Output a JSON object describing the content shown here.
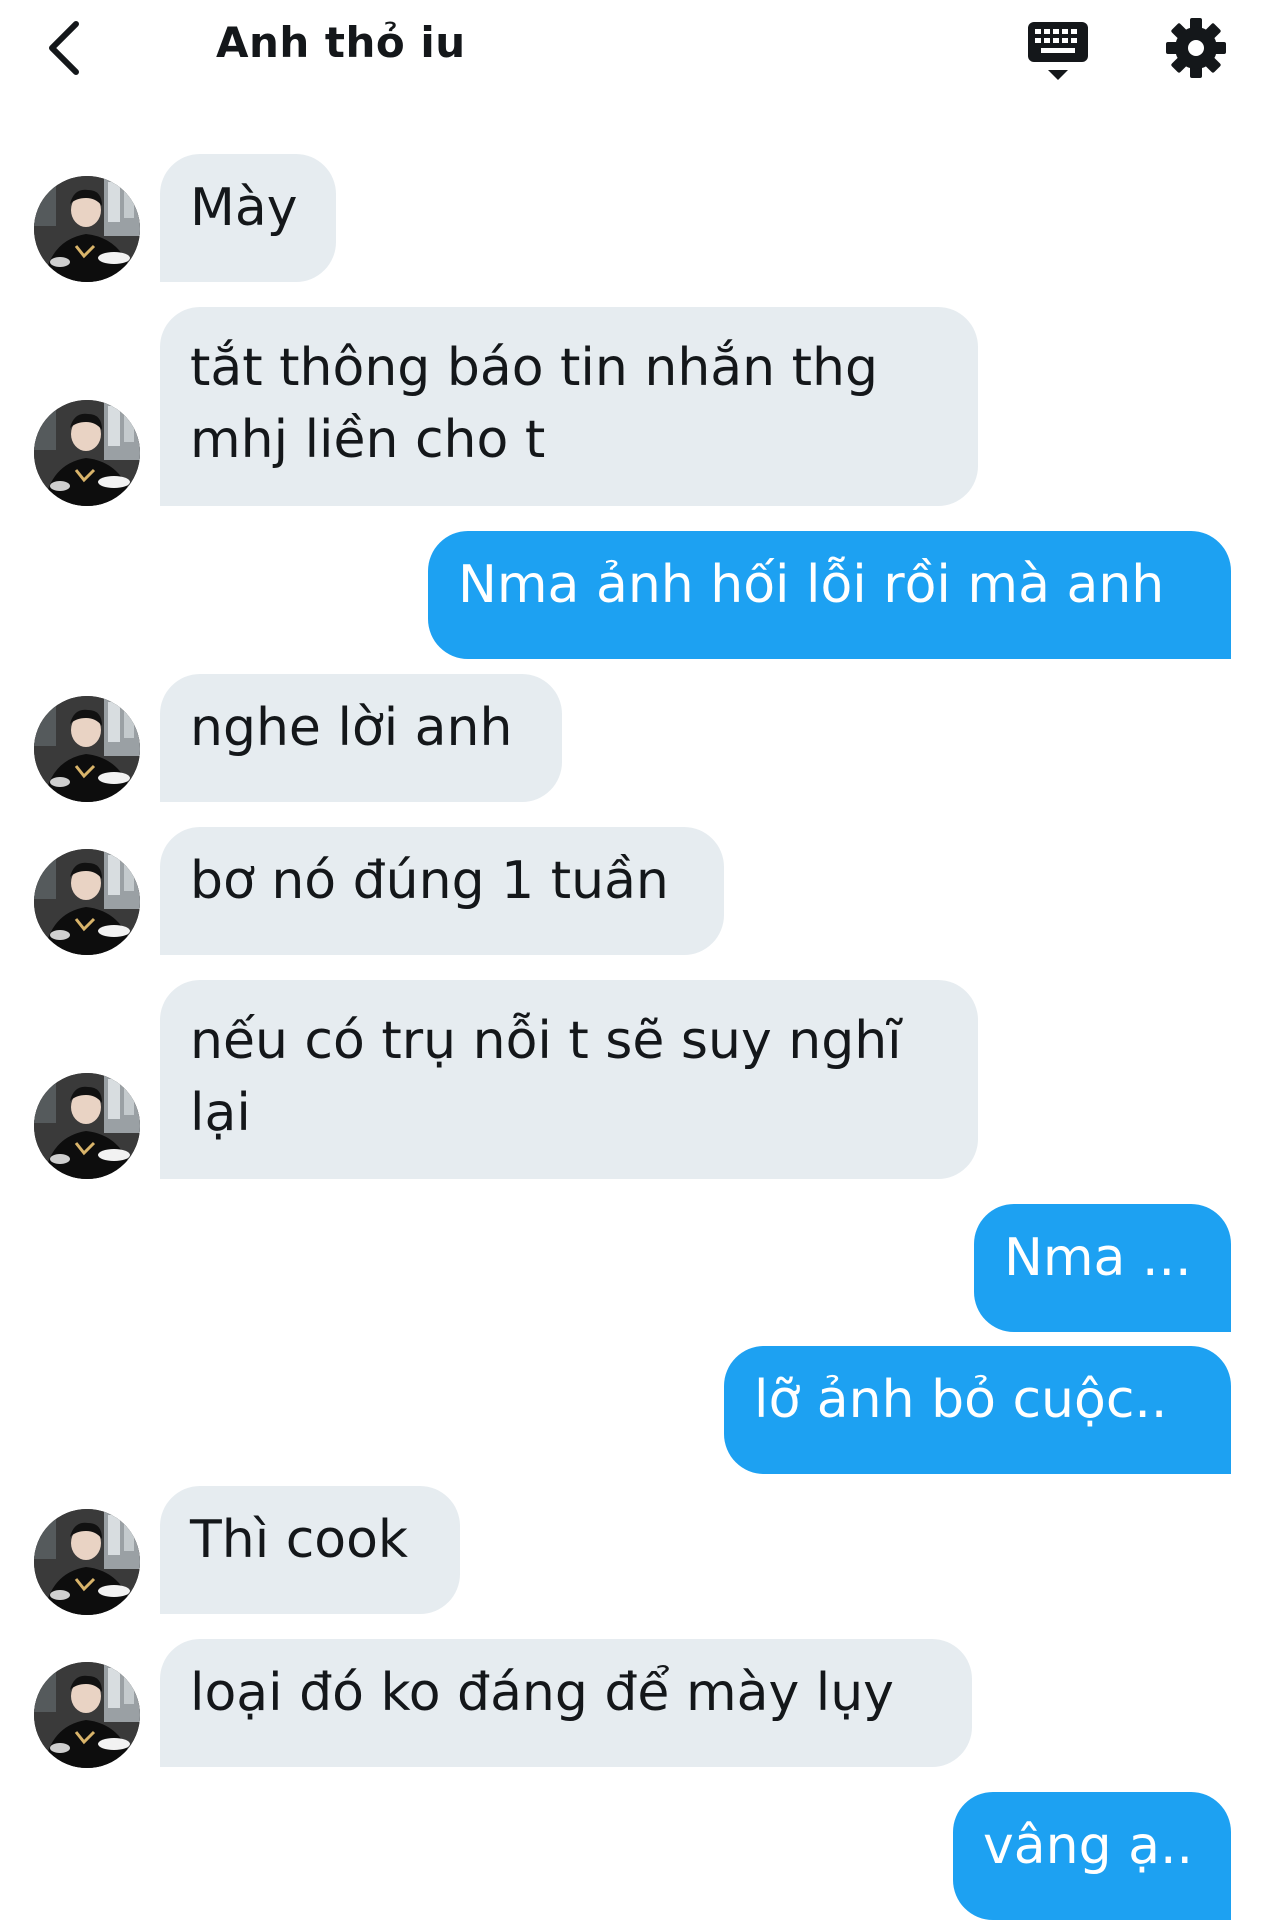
{
  "header": {
    "title": "Anh thỏ iu",
    "icons": {
      "back": "chevron-left-icon",
      "keyboard": "keyboard-icon",
      "settings": "gear-icon"
    }
  },
  "colors": {
    "incoming_bubble": "#e6ecf0",
    "outgoing_bubble": "#1da1f2",
    "text": "#14171a"
  },
  "messages": [
    {
      "sender": "them",
      "text": "Mày"
    },
    {
      "sender": "them",
      "text": "tắt thông báo tin nhắn thg mhj liền cho t"
    },
    {
      "sender": "me",
      "text": "Nma ảnh hối lỗi rồi mà anh"
    },
    {
      "sender": "them",
      "text": "nghe lời anh"
    },
    {
      "sender": "them",
      "text": "bơ nó đúng 1 tuần"
    },
    {
      "sender": "them",
      "text": "nếu có trụ nỗi t sẽ suy nghĩ lại"
    },
    {
      "sender": "me",
      "text": "Nma ..."
    },
    {
      "sender": "me",
      "text": "lỡ ảnh bỏ cuộc.."
    },
    {
      "sender": "them",
      "text": "Thì cook"
    },
    {
      "sender": "them",
      "text": "loại đó ko đáng để mày lụy"
    },
    {
      "sender": "me",
      "text": "vâng ạ.."
    }
  ]
}
